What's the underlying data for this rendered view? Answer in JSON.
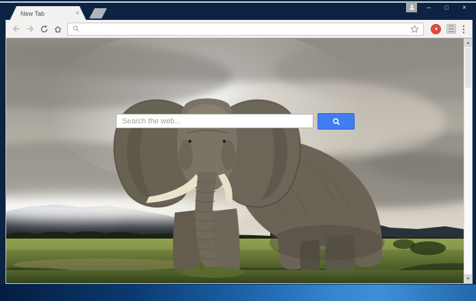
{
  "window": {
    "tab_title": "New Tab",
    "tab_close_glyph": "×",
    "minimize_glyph": "–",
    "maximize_glyph": "□",
    "close_glyph": "×",
    "profile_icon": "person",
    "menu_glyph": "⋮"
  },
  "toolbar": {
    "back_icon": "back-arrow",
    "forward_icon": "forward-arrow",
    "reload_icon": "reload",
    "home_icon": "home",
    "address_bar": {
      "value": "",
      "search_icon": "magnifier",
      "bookmark_icon": "star-outline"
    },
    "extensions": [
      {
        "name": "red-circle-arrow-extension",
        "color": "#df4b3c"
      },
      {
        "name": "gray-extension",
        "color": "#d7d7d7"
      }
    ]
  },
  "page": {
    "search_placeholder": "Search the web...",
    "search_button_icon": "magnifier",
    "scene": "african-elephant-grassland-photo"
  },
  "scrollbar": {
    "up_glyph": "▲",
    "down_glyph": "▼"
  },
  "colors": {
    "titlebar": "#0c2342",
    "toolbar": "#f3f2f0",
    "accent_blue": "#3f7df2",
    "extension_red": "#df4b3c",
    "taskbar_gradient": [
      "#041d3f",
      "#1d64aa",
      "#3f8fd6",
      "#2268ac"
    ]
  }
}
